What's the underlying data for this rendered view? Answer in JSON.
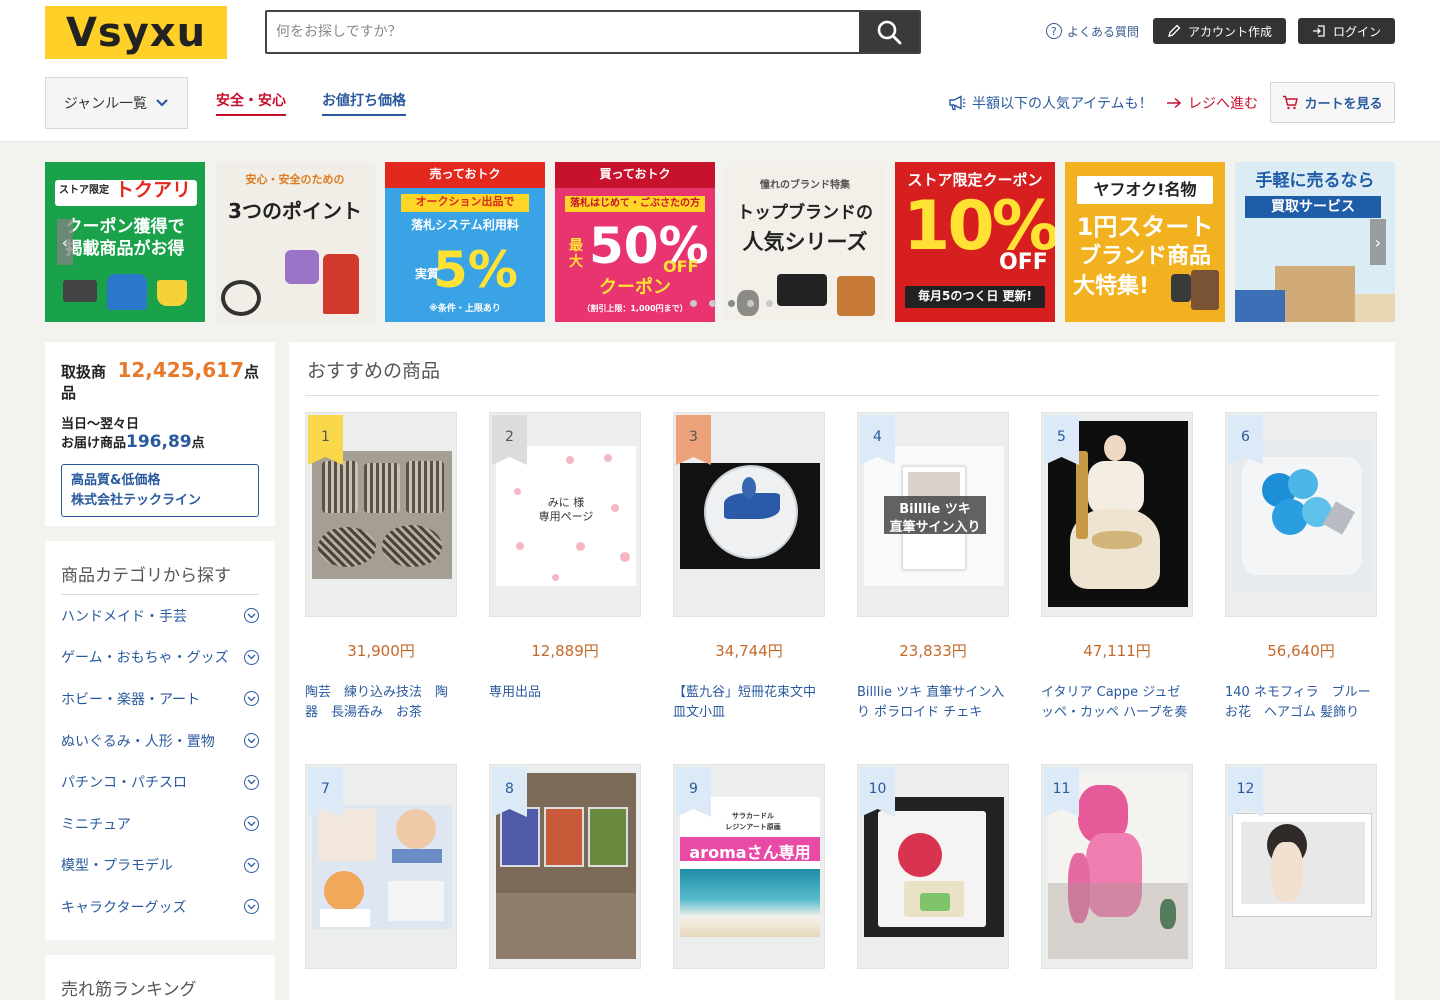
{
  "header": {
    "logo": "Vsyxu",
    "search_placeholder": "何をお探しですか？",
    "faq": "よくある質問",
    "create_account": "アカウント作成",
    "login": "ログイン"
  },
  "nav": {
    "genre": "ジャンル一覧",
    "safety": "安全・安心",
    "bargain": "お値打ち価格",
    "promo": "半額以下の人気アイテムも！",
    "register": "レジへ進む",
    "cart": "カートを見る"
  },
  "banners": [
    {
      "l1": "ストア限定",
      "l2": "トクアリ",
      "l3": "クーポン獲得で",
      "l4": "掲載商品がお得"
    },
    {
      "l1": "安心・安全のための",
      "l2": "3つのポイント"
    },
    {
      "l1": "売っておトク",
      "l2": "オークション出品で",
      "l3": "落札システム利用料",
      "l4": "実質",
      "l5": "5%",
      "l6": "※条件・上限あり"
    },
    {
      "l1": "買っておトク",
      "l2": "落札はじめて・ごぶさたの方",
      "l3": "最大",
      "l4": "50%",
      "l5": "OFF",
      "l6": "クーポン",
      "l7": "（割引上限：1,000円まで）"
    },
    {
      "l1": "憧れのブランド特集",
      "l2": "トップブランドの",
      "l3": "人気シリーズ"
    },
    {
      "l1": "ストア限定クーポン",
      "l2": "10%",
      "l3": "OFF",
      "l4": "毎月5のつく日 更新!"
    },
    {
      "l1": "ヤフオク!名物",
      "l2": "1円スタート",
      "l3": "ブランド商品",
      "l4": "大特集!"
    },
    {
      "l1": "手軽に売るなら",
      "l2": "買取サービス"
    }
  ],
  "stats": {
    "items_label": "取扱商品",
    "items_count": "12,425,617",
    "items_unit": "点",
    "delivery_label1": "当日〜翌々日",
    "delivery_label2": "お届け商品",
    "delivery_count": "196,89",
    "delivery_unit": "点",
    "company_line1": "高品質&低価格",
    "company_line2": "株式会社テックライン"
  },
  "categories": {
    "heading": "商品カテゴリから探す",
    "items": [
      "ハンドメイド・手芸",
      "ゲーム・おもちゃ・グッズ",
      "ホビー・楽器・アート",
      "ぬいぐるみ・人形・置物",
      "パチンコ・パチスロ",
      "ミニチュア",
      "模型・プラモデル",
      "キャラクターグッズ"
    ]
  },
  "ranking_heading": "売れ筋ランキング",
  "recommend": {
    "heading": "おすすめの商品",
    "products": [
      {
        "rank": "1",
        "price": "31,900円",
        "title": "陶芸　練り込み技法　陶器　長湯呑み　お茶"
      },
      {
        "rank": "2",
        "price": "12,889円",
        "title": "専用出品",
        "img_text1": "みに 様",
        "img_text2": "専用ページ"
      },
      {
        "rank": "3",
        "price": "34,744円",
        "title": "【藍九谷」短冊花束文中皿文小皿"
      },
      {
        "rank": "4",
        "price": "23,833円",
        "title": "Billlie ツキ 直筆サイン入り ポラロイド チェキ",
        "img_text1": "Billlie ツキ",
        "img_text2": "直筆サイン入り"
      },
      {
        "rank": "5",
        "price": "47,111円",
        "title": "イタリア Cappe ジュゼッペ・カッペ ハープを奏でる"
      },
      {
        "rank": "6",
        "price": "56,640円",
        "title": "140 ネモフィラ　ブルー　お花　ヘアゴム 髪飾り"
      },
      {
        "rank": "7",
        "price": "",
        "title": ""
      },
      {
        "rank": "8",
        "price": "",
        "title": ""
      },
      {
        "rank": "9",
        "price": "",
        "title": "",
        "img_text1": "サラカードル",
        "img_text2": "レジンアート原画",
        "img_text3": "aromaさん専用"
      },
      {
        "rank": "10",
        "price": "",
        "title": ""
      },
      {
        "rank": "11",
        "price": "",
        "title": ""
      },
      {
        "rank": "12",
        "price": "",
        "title": ""
      }
    ]
  },
  "colors": {
    "logo_bg": "#ffd027",
    "accent_red": "#c8102e",
    "link_blue": "#2a5a9e",
    "price_orange": "#c4692b",
    "highlight_orange": "#e8782a"
  }
}
